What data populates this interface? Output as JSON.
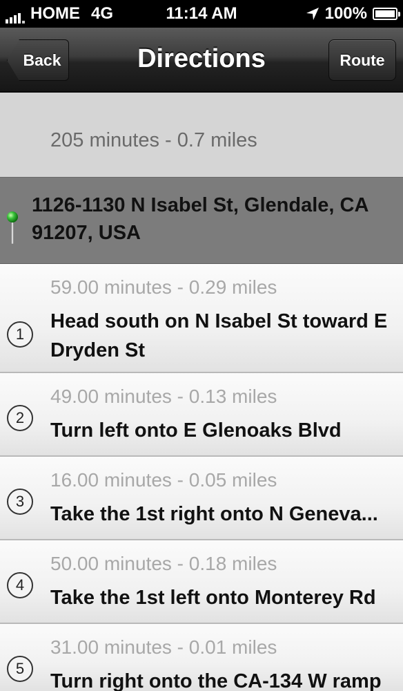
{
  "status_bar": {
    "carrier": "HOME",
    "network": "4G",
    "time": "11:14 AM",
    "battery": "100%",
    "battery_level": 1.0
  },
  "nav": {
    "back_label": "Back",
    "title": "Directions",
    "route_label": "Route"
  },
  "summary": {
    "text": "205 minutes - 0.7 miles"
  },
  "destination": {
    "address": "1126-1130 N Isabel St, Glendale, CA 91207, USA",
    "icon": "map-pin-icon",
    "pin_color": "#3cc43c"
  },
  "steps": [
    {
      "number": "1",
      "meta": "59.00 minutes - 0.29 miles",
      "instruction": "Head south on N Isabel St toward E Dryden St"
    },
    {
      "number": "2",
      "meta": "49.00 minutes - 0.13 miles",
      "instruction": "Turn left onto E Glenoaks Blvd"
    },
    {
      "number": "3",
      "meta": "16.00 minutes - 0.05 miles",
      "instruction": "Take the 1st right onto N Geneva..."
    },
    {
      "number": "4",
      "meta": "50.00 minutes - 0.18 miles",
      "instruction": "Take the 1st left onto Monterey Rd"
    },
    {
      "number": "5",
      "meta": "31.00 minutes - 0.01 miles",
      "instruction": "Turn right onto the CA-134 W ramp"
    }
  ]
}
